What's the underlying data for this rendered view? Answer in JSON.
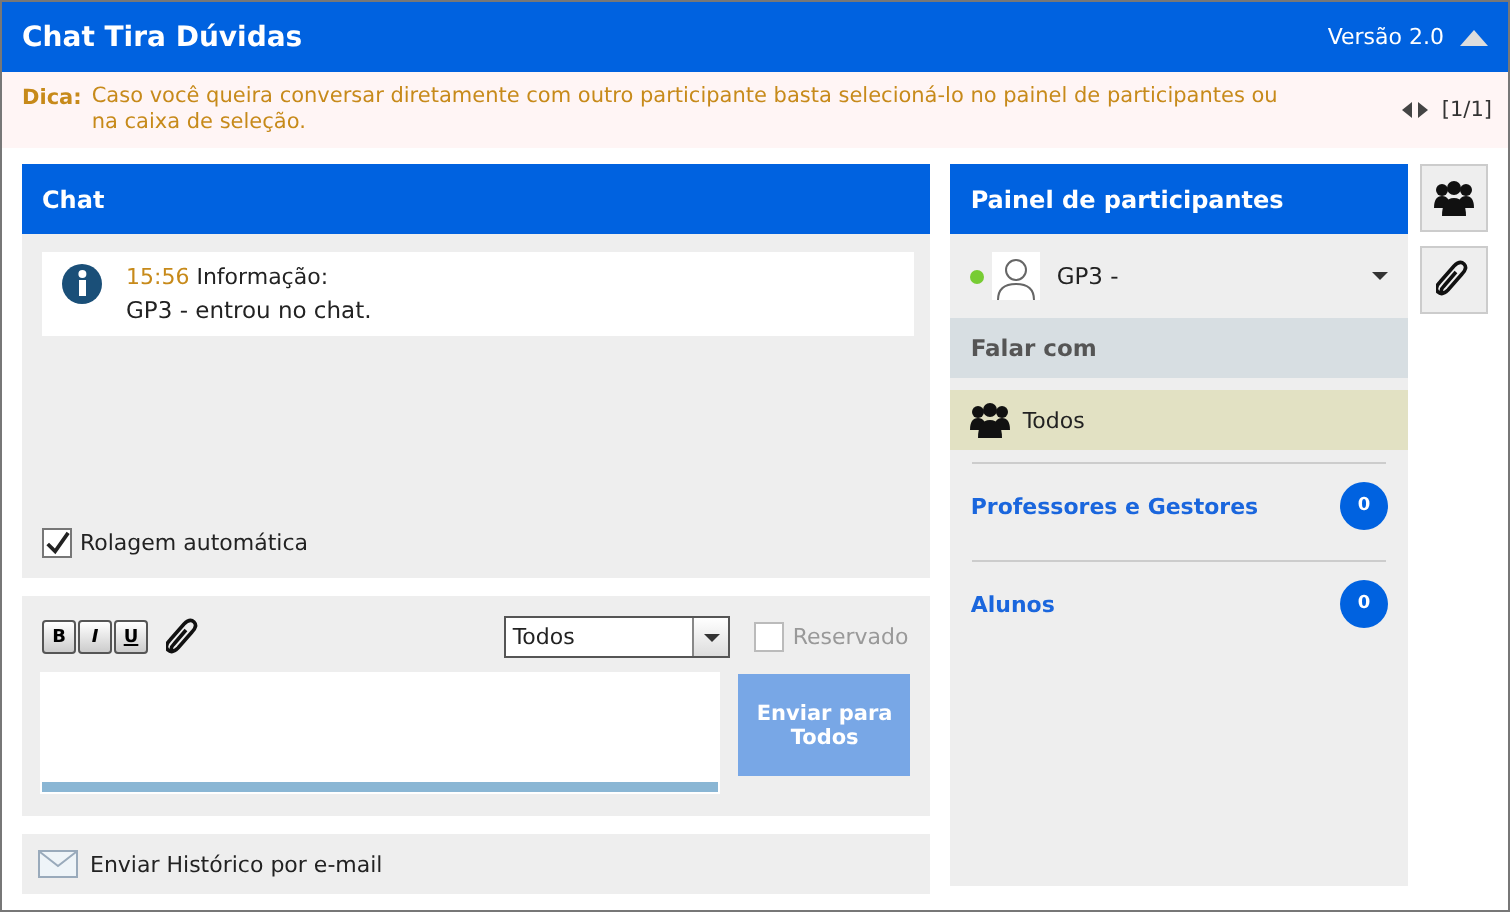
{
  "window": {
    "title": "Chat Tira Dúvidas",
    "version": "Versão 2.0"
  },
  "tip": {
    "label": "Dica:",
    "text": "Caso você queira conversar diretamente com outro participante basta selecioná-lo no painel de participantes ou na caixa de seleção.",
    "pager": "[1/1]"
  },
  "chat": {
    "title": "Chat",
    "messages": [
      {
        "time": "15:56",
        "label": "Informação:",
        "text": "GP3 - entrou no chat."
      }
    ],
    "autoscroll": {
      "label": "Rolagem automática",
      "checked": true
    }
  },
  "compose": {
    "format_buttons": [
      "B",
      "I",
      "U"
    ],
    "recipient": "Todos",
    "reserved": {
      "label": "Reservado",
      "checked": false,
      "disabled": true
    },
    "send_button": "Enviar para Todos"
  },
  "email_link": "Enviar Histórico por e-mail",
  "participants": {
    "title": "Painel de participantes",
    "user": {
      "name": "GP3 -",
      "online": true
    },
    "talk_with": "Falar com",
    "everyone": {
      "label": "Todos",
      "selected": true
    },
    "groups": [
      {
        "name": "Professores e Gestores",
        "count": "0"
      },
      {
        "name": "Alunos",
        "count": "0"
      }
    ]
  }
}
